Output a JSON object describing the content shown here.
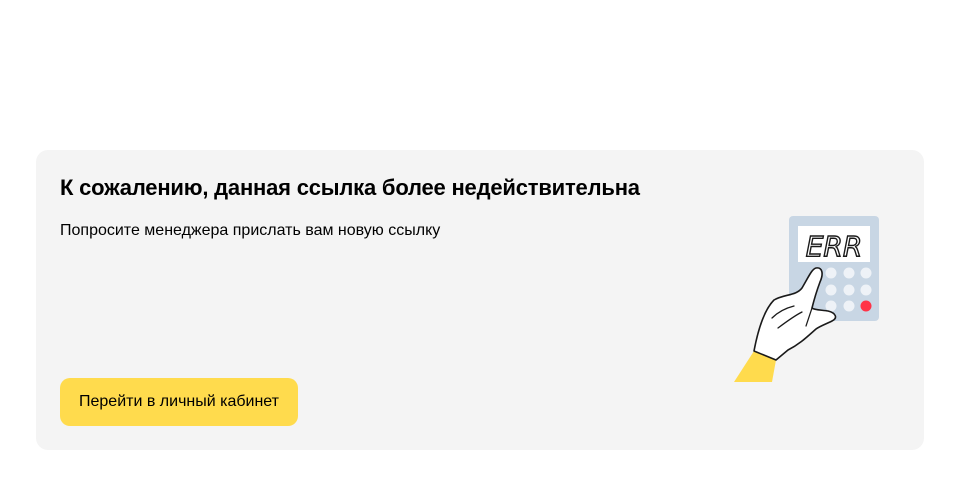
{
  "error": {
    "title": "К сожалению, данная ссылка более недействительна",
    "message": "Попросите менеджера прислать вам новую ссылку",
    "button_label": "Перейти в личный кабинет"
  },
  "illustration": {
    "display_text": "ERR",
    "icon": "calculator-error-icon"
  },
  "colors": {
    "accent": "#ffdb4d",
    "card_background": "#f4f4f4",
    "calculator_body": "#c8d6e4",
    "error_key": "#ff3347"
  }
}
